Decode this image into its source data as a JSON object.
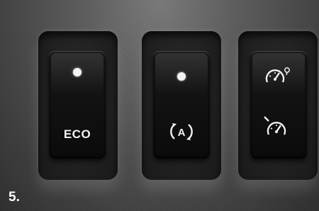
{
  "caption": "5.",
  "switches": [
    {
      "label": "ECO",
      "indicator": "led-on",
      "icon": "eco-text"
    },
    {
      "label": "",
      "indicator": "led-on",
      "icon": "stop-start-auto-icon"
    },
    {
      "label": "",
      "indicator": "none",
      "icon": "speed-limiter-cruise-icons"
    }
  ]
}
